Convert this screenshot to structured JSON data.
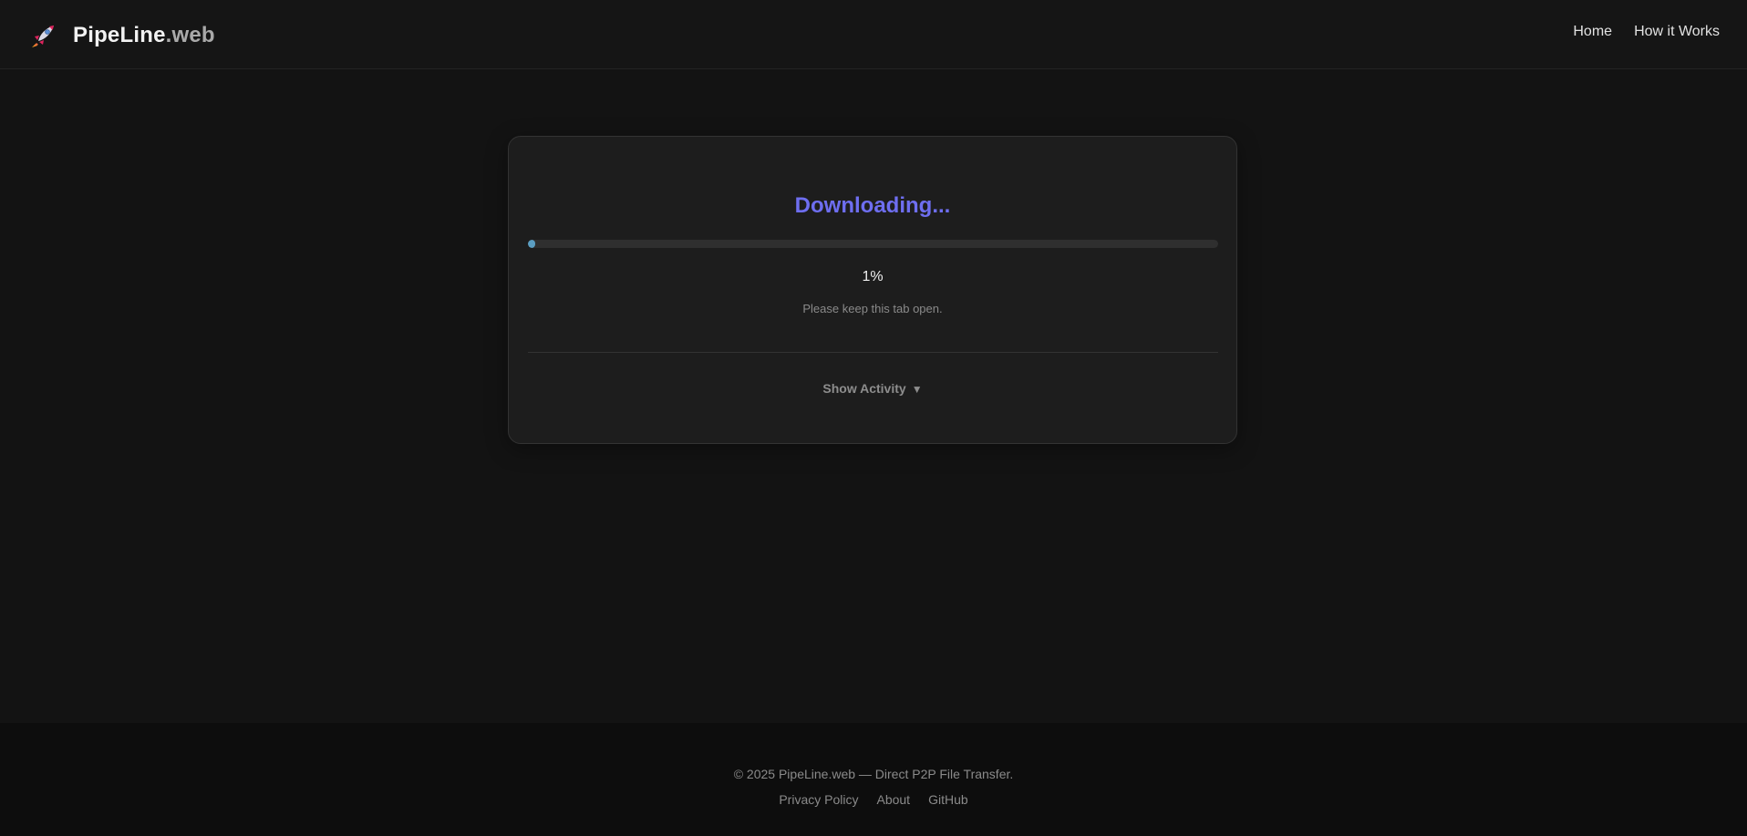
{
  "header": {
    "brand": {
      "icon": "rocket-icon",
      "name_primary": "PipeLine",
      "name_secondary": ".web"
    },
    "nav": [
      {
        "label": "Home"
      },
      {
        "label": "How it Works"
      }
    ]
  },
  "transfer": {
    "status_title": "Downloading...",
    "progress_percent": 1,
    "progress_label": "1%",
    "hint": "Please keep this tab open.",
    "activity_toggle_label": "Show Activity",
    "activity_toggle_icon": "caret-down-icon"
  },
  "footer": {
    "copyright": "© 2025 PipeLine.web — Direct P2P File Transfer.",
    "links": [
      {
        "label": "Privacy Policy"
      },
      {
        "label": "About"
      },
      {
        "label": "GitHub"
      }
    ]
  },
  "colors": {
    "accent": "#6e6ef0",
    "progress": "#5b9ec2",
    "background": "#131313",
    "card": "#1d1d1d"
  }
}
